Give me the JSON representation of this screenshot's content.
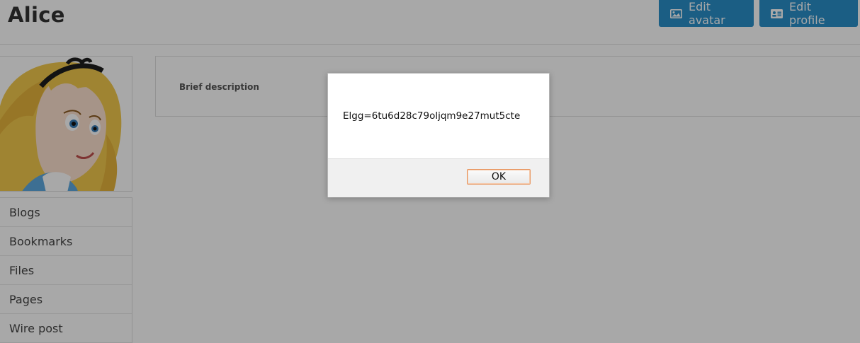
{
  "profile": {
    "name": "Alice"
  },
  "header": {
    "edit_avatar_label": "Edit avatar",
    "edit_avatar_icon": "image-icon",
    "edit_profile_label": "Edit profile",
    "edit_profile_icon": "id-card-icon"
  },
  "sidebar": {
    "items": [
      {
        "label": "Blogs"
      },
      {
        "label": "Bookmarks"
      },
      {
        "label": "Files"
      },
      {
        "label": "Pages"
      },
      {
        "label": "Wire post"
      }
    ]
  },
  "details": {
    "brief_description_label": "Brief description"
  },
  "alert": {
    "message": "Elgg=6tu6d28c79oljqm9e27mut5cte",
    "ok_label": "OK"
  },
  "colors": {
    "accent": "#2a8fc9",
    "overlay": "rgba(0,0,0,0.34)",
    "ok_button_border": "#e8955f"
  }
}
